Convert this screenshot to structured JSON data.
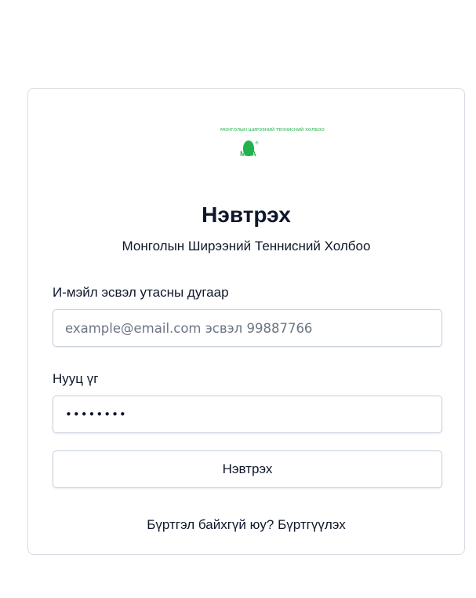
{
  "logo": {
    "top_text": "МОНГОЛЫН ШИРЭЭНИЙ ТЕННИСНИЙ ХОЛБОО",
    "letters": "MTA",
    "reg_mark": "®"
  },
  "login": {
    "title": "Нэвтрэх",
    "subtitle": "Монголын Ширээний Теннисний Холбоо",
    "email_label": "И-мэйл эсвэл утасны дугаар",
    "email_placeholder": "example@email.com эсвэл 99887766",
    "email_value": "",
    "password_label": "Нууц үг",
    "password_value": "********",
    "submit_label": "Нэвтрэх",
    "register_prompt": "Бүртгэл байхгүй юу?",
    "register_link": "Бүртгүүлэх"
  },
  "colors": {
    "brand_green": "#22b24c",
    "text": "#0f172a",
    "border": "#c7d0dc"
  }
}
